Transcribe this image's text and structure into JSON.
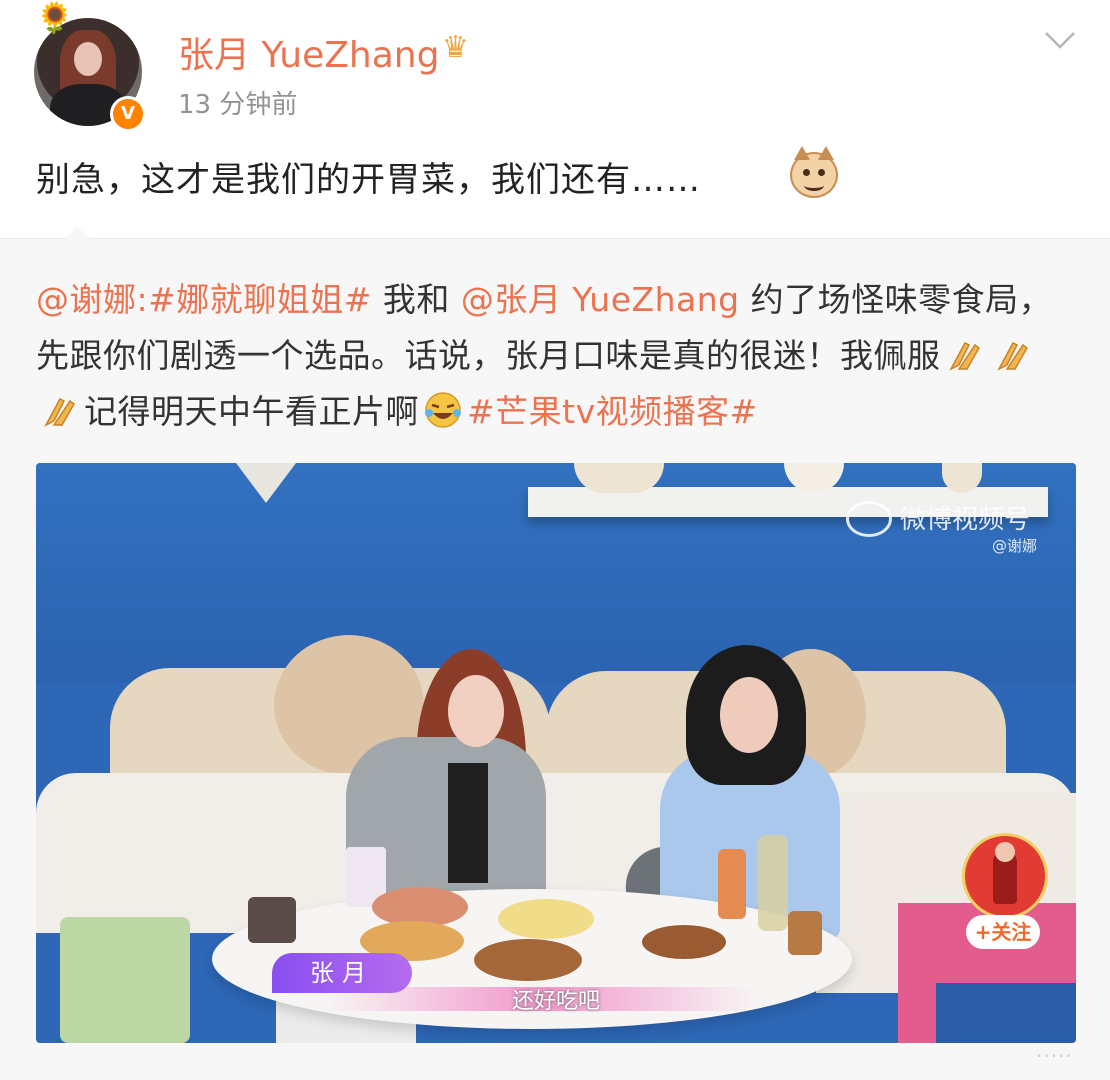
{
  "post": {
    "username": "张月 YueZhang",
    "time": "13 分钟前",
    "text": "别急，这才是我们的开胃菜，我们还有……",
    "icons": [
      "sunflower-icon",
      "verified-badge-icon",
      "crown-icon",
      "chevron-down-icon",
      "cat-emoji-icon"
    ]
  },
  "repost": {
    "author_mention": "@谢娜",
    "sep": ":",
    "topic1": "#娜就聊姐姐#",
    "text1": " 我和 ",
    "mention2": "@张月 YueZhang",
    "text2": " 约了场怪味零食局，先跟你们剧透一个选品。话说，张月口味是真的很迷！我佩服",
    "text3": "记得明天中午看正片啊",
    "topic2": "#芒果tv视频播客#",
    "emoji": [
      "clap-emoji-icon",
      "clap-emoji-icon",
      "clap-emoji-icon",
      "laugh-cry-emoji-icon"
    ]
  },
  "video": {
    "watermark": "微博视频号",
    "watermark_user": "@谢娜",
    "name_tag": "张月",
    "subtitle": "还好吃吧",
    "follow_label": "+关注"
  },
  "footer": {
    "more": "·····"
  }
}
